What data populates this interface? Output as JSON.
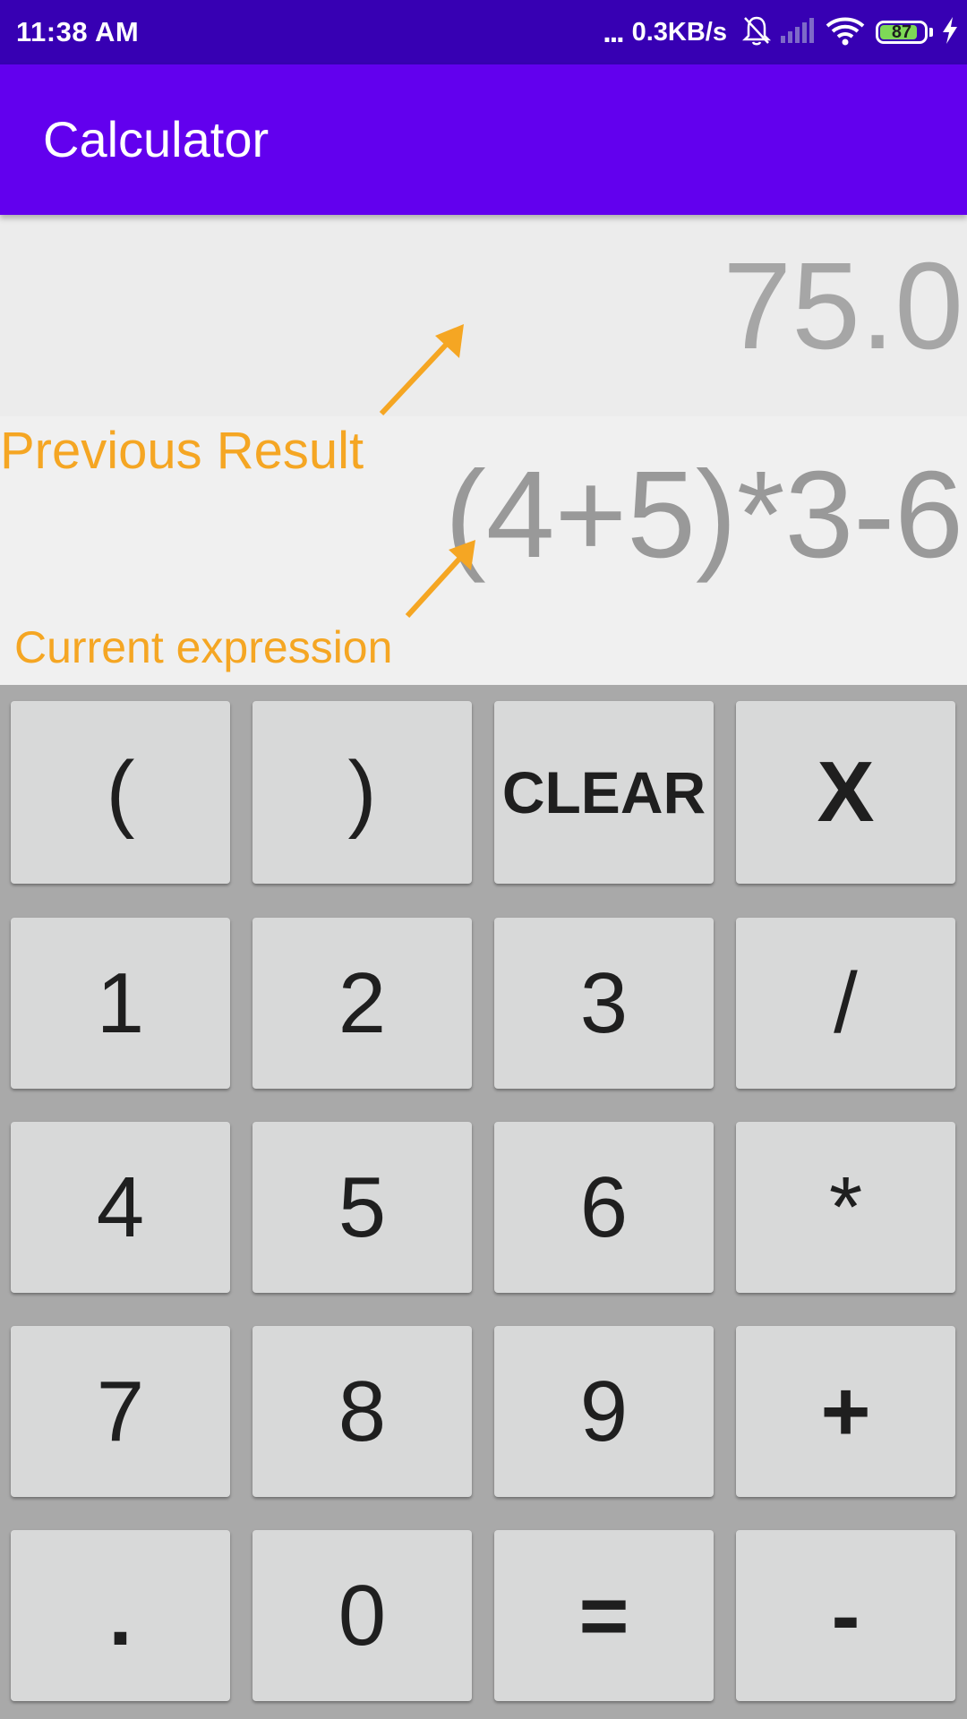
{
  "status_bar": {
    "time": "11:38 AM",
    "more": "...",
    "net_speed": "0.3KB/s",
    "battery_level": "87",
    "battery_fraction": 0.87
  },
  "app_bar": {
    "title": "Calculator"
  },
  "display": {
    "previous_result": "75.0",
    "current_expression": "(4+5)*3-6"
  },
  "annotations": {
    "previous_result_label": "Previous Result",
    "current_expression_label": "Current expression",
    "color": "#f5a623"
  },
  "keypad": {
    "keys": [
      {
        "label": "("
      },
      {
        "label": ")"
      },
      {
        "label": "CLEAR"
      },
      {
        "label": "X"
      },
      {
        "label": "1"
      },
      {
        "label": "2"
      },
      {
        "label": "3"
      },
      {
        "label": "/"
      },
      {
        "label": "4"
      },
      {
        "label": "5"
      },
      {
        "label": "6"
      },
      {
        "label": "*"
      },
      {
        "label": "7"
      },
      {
        "label": "8"
      },
      {
        "label": "9"
      },
      {
        "label": "+"
      },
      {
        "label": "."
      },
      {
        "label": "0"
      },
      {
        "label": "="
      },
      {
        "label": "-"
      }
    ]
  },
  "colors": {
    "status_bar": "#3700b3",
    "app_bar": "#6200ee",
    "key": "#d8d9d9",
    "keypad_background": "#a9a9a9"
  }
}
